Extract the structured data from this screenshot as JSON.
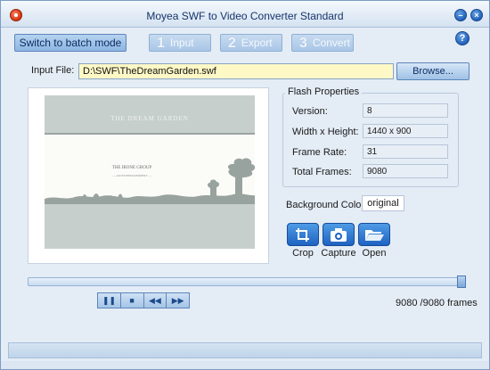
{
  "app": {
    "title": "Moyea SWF to Video Converter Standard"
  },
  "toolbar": {
    "batch_label": "Switch to batch mode",
    "steps": [
      {
        "num": "1",
        "label": "Input"
      },
      {
        "num": "2",
        "label": "Export"
      },
      {
        "num": "3",
        "label": "Convert"
      }
    ],
    "help_glyph": "?"
  },
  "input_file": {
    "label": "Input File:",
    "value": "D:\\SWF\\TheDreamGarden.swf",
    "browse_label": "Browse..."
  },
  "preview": {
    "title": "THE DREAM GARDEN",
    "brand": "THE IRONE GROUP",
    "sub": "— AN ENTERTAINMENT —"
  },
  "flash_properties": {
    "title": "Flash Properties",
    "rows": [
      {
        "label": "Version:",
        "value": "8"
      },
      {
        "label": "Width x Height:",
        "value": "1440 x 900"
      },
      {
        "label": "Frame Rate:",
        "value": "31"
      },
      {
        "label": "Total Frames:",
        "value": "9080"
      }
    ]
  },
  "background": {
    "label": "Background Color:",
    "value": "original"
  },
  "actions": {
    "crop": "Crop",
    "capture": "Capture",
    "open": "Open"
  },
  "playback": {
    "progress": 1.0,
    "frames_text": "9080 /9080 frames"
  },
  "colors": {
    "accent": "#1f63c2",
    "window_bg": "#e4ecf5",
    "input_bg": "#fdf8c6"
  }
}
